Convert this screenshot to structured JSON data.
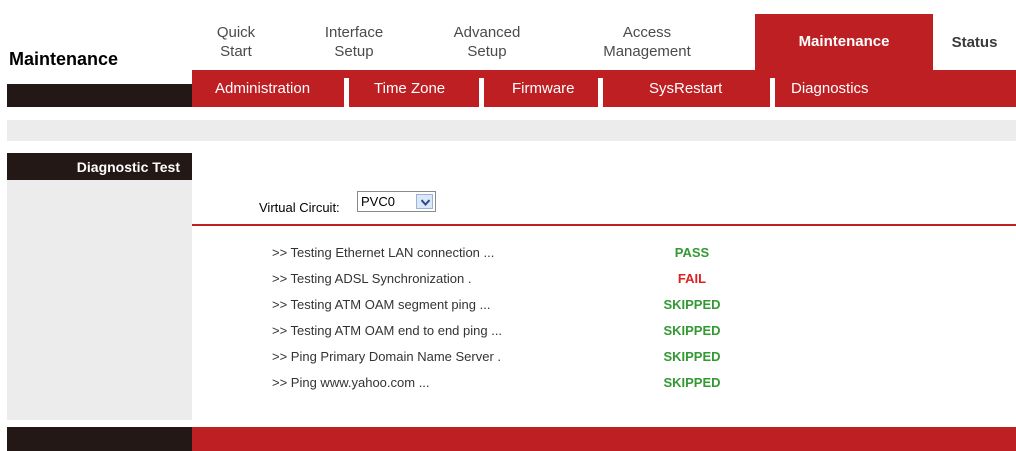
{
  "page": {
    "section_title": "Maintenance"
  },
  "tabs": [
    {
      "line1": "Quick",
      "line2": "Start"
    },
    {
      "line1": "Interface",
      "line2": "Setup"
    },
    {
      "line1": "Advanced",
      "line2": "Setup"
    },
    {
      "line1": "Access",
      "line2": "Management"
    },
    {
      "label": "Maintenance",
      "active": true
    },
    {
      "label": "Status"
    }
  ],
  "subtabs": [
    "Administration",
    "Time Zone",
    "Firmware",
    "SysRestart",
    "Diagnostics"
  ],
  "sidebar": {
    "heading": "Diagnostic Test"
  },
  "virtual_circuit": {
    "label": "Virtual Circuit:",
    "value": "PVC0"
  },
  "tests": [
    {
      "name": ">> Testing Ethernet LAN connection ...",
      "result": "PASS",
      "status": "pass"
    },
    {
      "name": ">> Testing ADSL Synchronization .",
      "result": "FAIL",
      "status": "fail"
    },
    {
      "name": ">> Testing ATM OAM segment ping ...",
      "result": "SKIPPED",
      "status": "pass"
    },
    {
      "name": ">> Testing ATM OAM end to end ping ...",
      "result": "SKIPPED",
      "status": "pass"
    },
    {
      "name": ">> Ping Primary Domain Name Server .",
      "result": "SKIPPED",
      "status": "pass"
    },
    {
      "name": ">> Ping www.yahoo.com ...",
      "result": "SKIPPED",
      "status": "pass"
    }
  ],
  "colors": {
    "brand_red": "#bd1f22",
    "dark": "#231815",
    "pass_green": "#339933",
    "fail_red": "#e02020"
  }
}
